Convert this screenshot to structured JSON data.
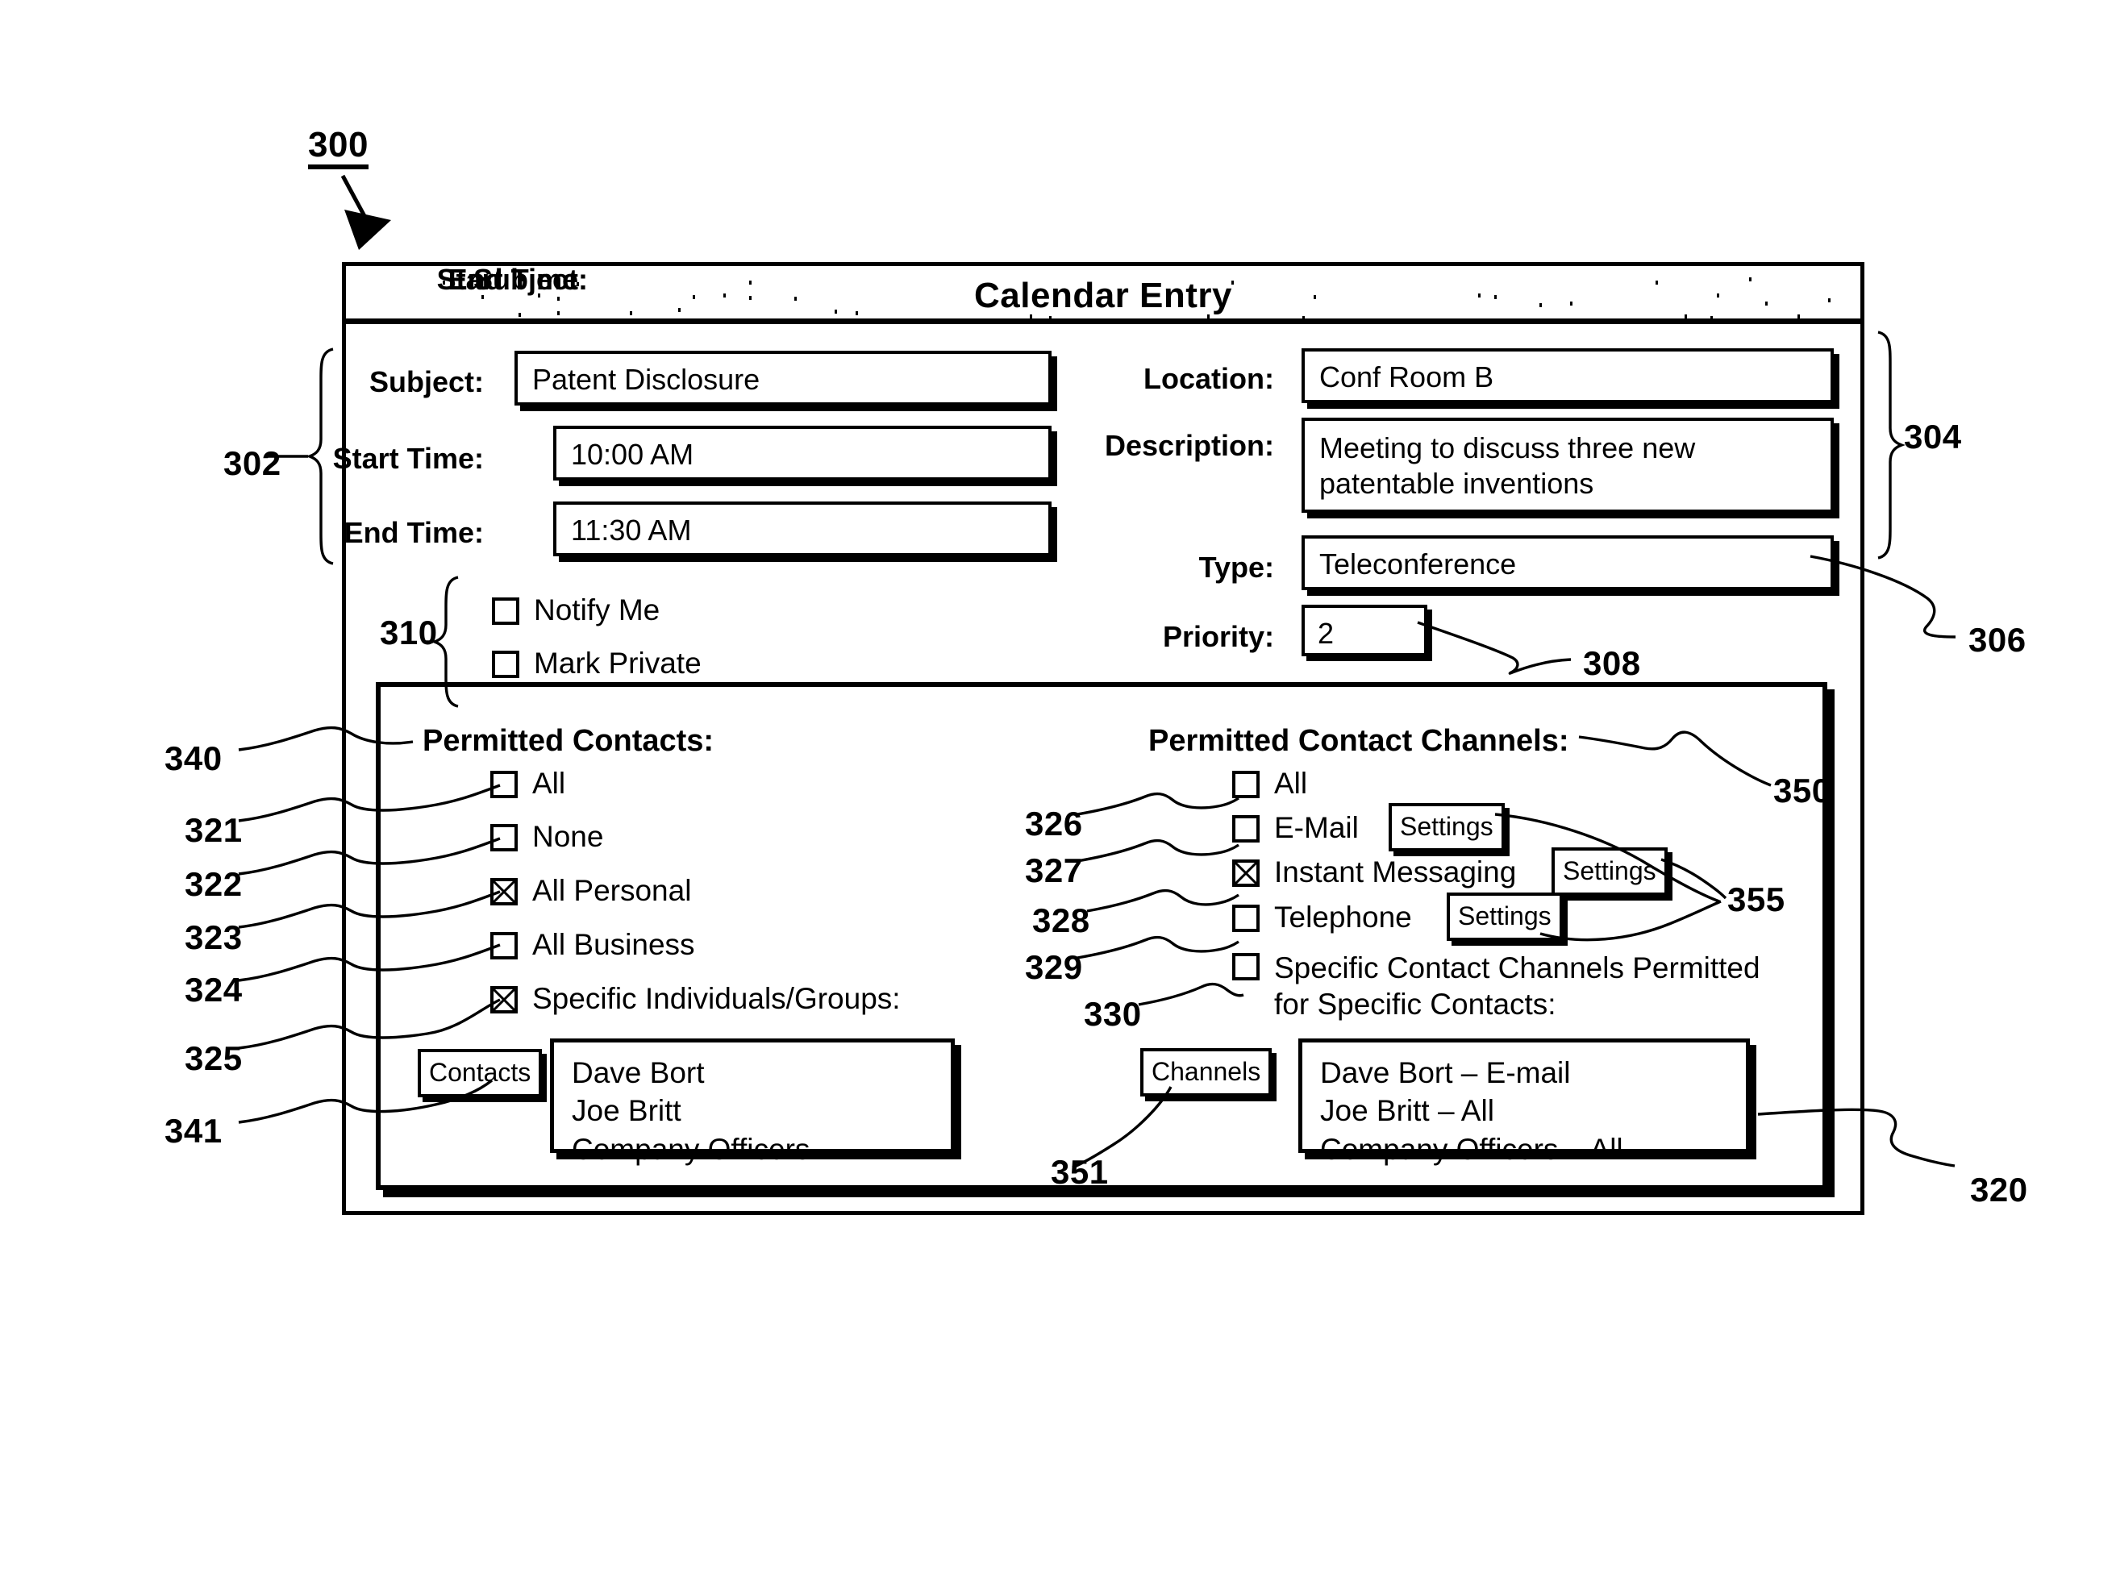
{
  "figure": {
    "number": "300",
    "callouts": {
      "form_left_group": "302",
      "form_right_group": "304",
      "type_field": "306",
      "priority_field": "308",
      "flags_group": "310",
      "permissions_panel": "320",
      "contacts_all": "321",
      "contacts_none": "322",
      "contacts_all_personal": "323",
      "contacts_all_business": "324",
      "contacts_specific": "325",
      "channels_all": "326",
      "channels_email": "327",
      "channels_im": "328",
      "channels_telephone": "329",
      "channels_specific": "330",
      "permitted_contacts_heading": "340",
      "contacts_button": "341",
      "permitted_channels_heading": "350",
      "channels_button": "351",
      "settings_buttons": "355"
    }
  },
  "window": {
    "title": "Calendar Entry"
  },
  "form": {
    "left_fields": [
      {
        "label": "Subject:",
        "value": "Patent Disclosure"
      },
      {
        "label": "Start Time:",
        "value": "10:00 AM"
      },
      {
        "label": "End Time:",
        "value": "11:30 AM"
      }
    ],
    "right_fields": [
      {
        "label": "Location:",
        "value": "Conf Room B"
      },
      {
        "label": "Description:",
        "value": "Meeting to discuss three new patentable inventions"
      },
      {
        "label": "Type:",
        "value": "Teleconference"
      },
      {
        "label": "Priority:",
        "value": "2"
      }
    ],
    "flags": [
      {
        "label": "Notify Me",
        "checked": false
      },
      {
        "label": "Mark Private",
        "checked": false
      }
    ]
  },
  "permissions": {
    "contacts": {
      "heading": "Permitted Contacts:",
      "options": [
        {
          "label": "All",
          "checked": false
        },
        {
          "label": "None",
          "checked": false
        },
        {
          "label": "All Personal",
          "checked": true
        },
        {
          "label": "All Business",
          "checked": false
        },
        {
          "label": "Specific Individuals/Groups:",
          "checked": true
        }
      ],
      "button_label": "Contacts",
      "list_items": [
        "Dave Bort",
        "Joe Britt",
        "Company Officers"
      ]
    },
    "channels": {
      "heading": "Permitted Contact Channels:",
      "options": [
        {
          "label": "All",
          "checked": false,
          "settings": null
        },
        {
          "label": "E-Mail",
          "checked": false,
          "settings": "Settings"
        },
        {
          "label": "Instant Messaging",
          "checked": true,
          "settings": "Settings"
        },
        {
          "label": "Telephone",
          "checked": false,
          "settings": "Settings"
        },
        {
          "label": "Specific Contact Channels Permitted for Specific Contacts:",
          "checked": false,
          "settings": null
        }
      ],
      "button_label": "Channels",
      "list_items": [
        "Dave Bort – E-mail",
        "Joe Britt – All",
        "Company Officers – All"
      ]
    }
  }
}
